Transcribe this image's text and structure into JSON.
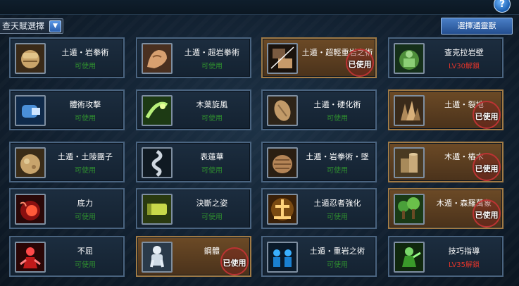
{
  "header": {
    "filter_label": "查天賦選擇",
    "pick_button": "選擇通靈獸",
    "help_label": "?"
  },
  "cards": [
    {
      "name": "土遁・岩拳術",
      "status": "可使用",
      "used": false,
      "icon": "rock-fist-icon"
    },
    {
      "name": "土遁・超岩拳術",
      "status": "可使用",
      "used": false,
      "icon": "muscle-arm-icon"
    },
    {
      "name": "土遁・超輕重岩之術",
      "status": "",
      "used": true,
      "icon": "heavy-fist-icon"
    },
    {
      "name": "查克拉岩壁",
      "status": "LV30解鎖",
      "used": false,
      "locked": true,
      "icon": "chakra-wall-icon"
    },
    {
      "name": "體術攻擊",
      "status": "可使用",
      "used": false,
      "icon": "punch-icon"
    },
    {
      "name": "木葉旋風",
      "status": "可使用",
      "used": false,
      "icon": "whirlwind-kick-icon"
    },
    {
      "name": "土遁・硬化術",
      "status": "可使用",
      "used": false,
      "icon": "stone-shield-icon"
    },
    {
      "name": "土遁・裂地",
      "status": "",
      "used": true,
      "icon": "crystal-spike-icon"
    },
    {
      "name": "土遁・土陵團子",
      "status": "可使用",
      "used": false,
      "icon": "boulder-icon"
    },
    {
      "name": "表蓮華",
      "status": "可使用",
      "used": false,
      "icon": "spiral-icon"
    },
    {
      "name": "土遁・岩拳術・墜",
      "status": "可使用",
      "used": false,
      "icon": "rock-cone-icon"
    },
    {
      "name": "木遁・樁木",
      "status": "",
      "used": true,
      "icon": "wood-stake-icon"
    },
    {
      "name": "底力",
      "status": "可使用",
      "used": false,
      "icon": "red-aura-icon"
    },
    {
      "name": "決斷之姿",
      "status": "可使用",
      "used": false,
      "icon": "scroll-icon"
    },
    {
      "name": "土遁忍者強化",
      "status": "可使用",
      "used": false,
      "icon": "earth-kanji-icon"
    },
    {
      "name": "木遁・森羅萬象",
      "status": "",
      "used": true,
      "icon": "forest-icon"
    },
    {
      "name": "不屈",
      "status": "可使用",
      "used": false,
      "icon": "red-ninja-icon"
    },
    {
      "name": "鋼體",
      "status": "",
      "used": true,
      "icon": "steel-body-icon"
    },
    {
      "name": "土遁・重岩之術",
      "status": "可使用",
      "used": false,
      "icon": "blue-ninjas-icon"
    },
    {
      "name": "技巧指導",
      "status": "LV35解鎖",
      "used": false,
      "locked": true,
      "icon": "green-ninja-icon"
    }
  ],
  "used_stamp": "已使用",
  "colors": {
    "available": "#2f8f2f",
    "locked": "#e0342b",
    "used_border": "#a07a45",
    "card_border": "#4a6480"
  }
}
